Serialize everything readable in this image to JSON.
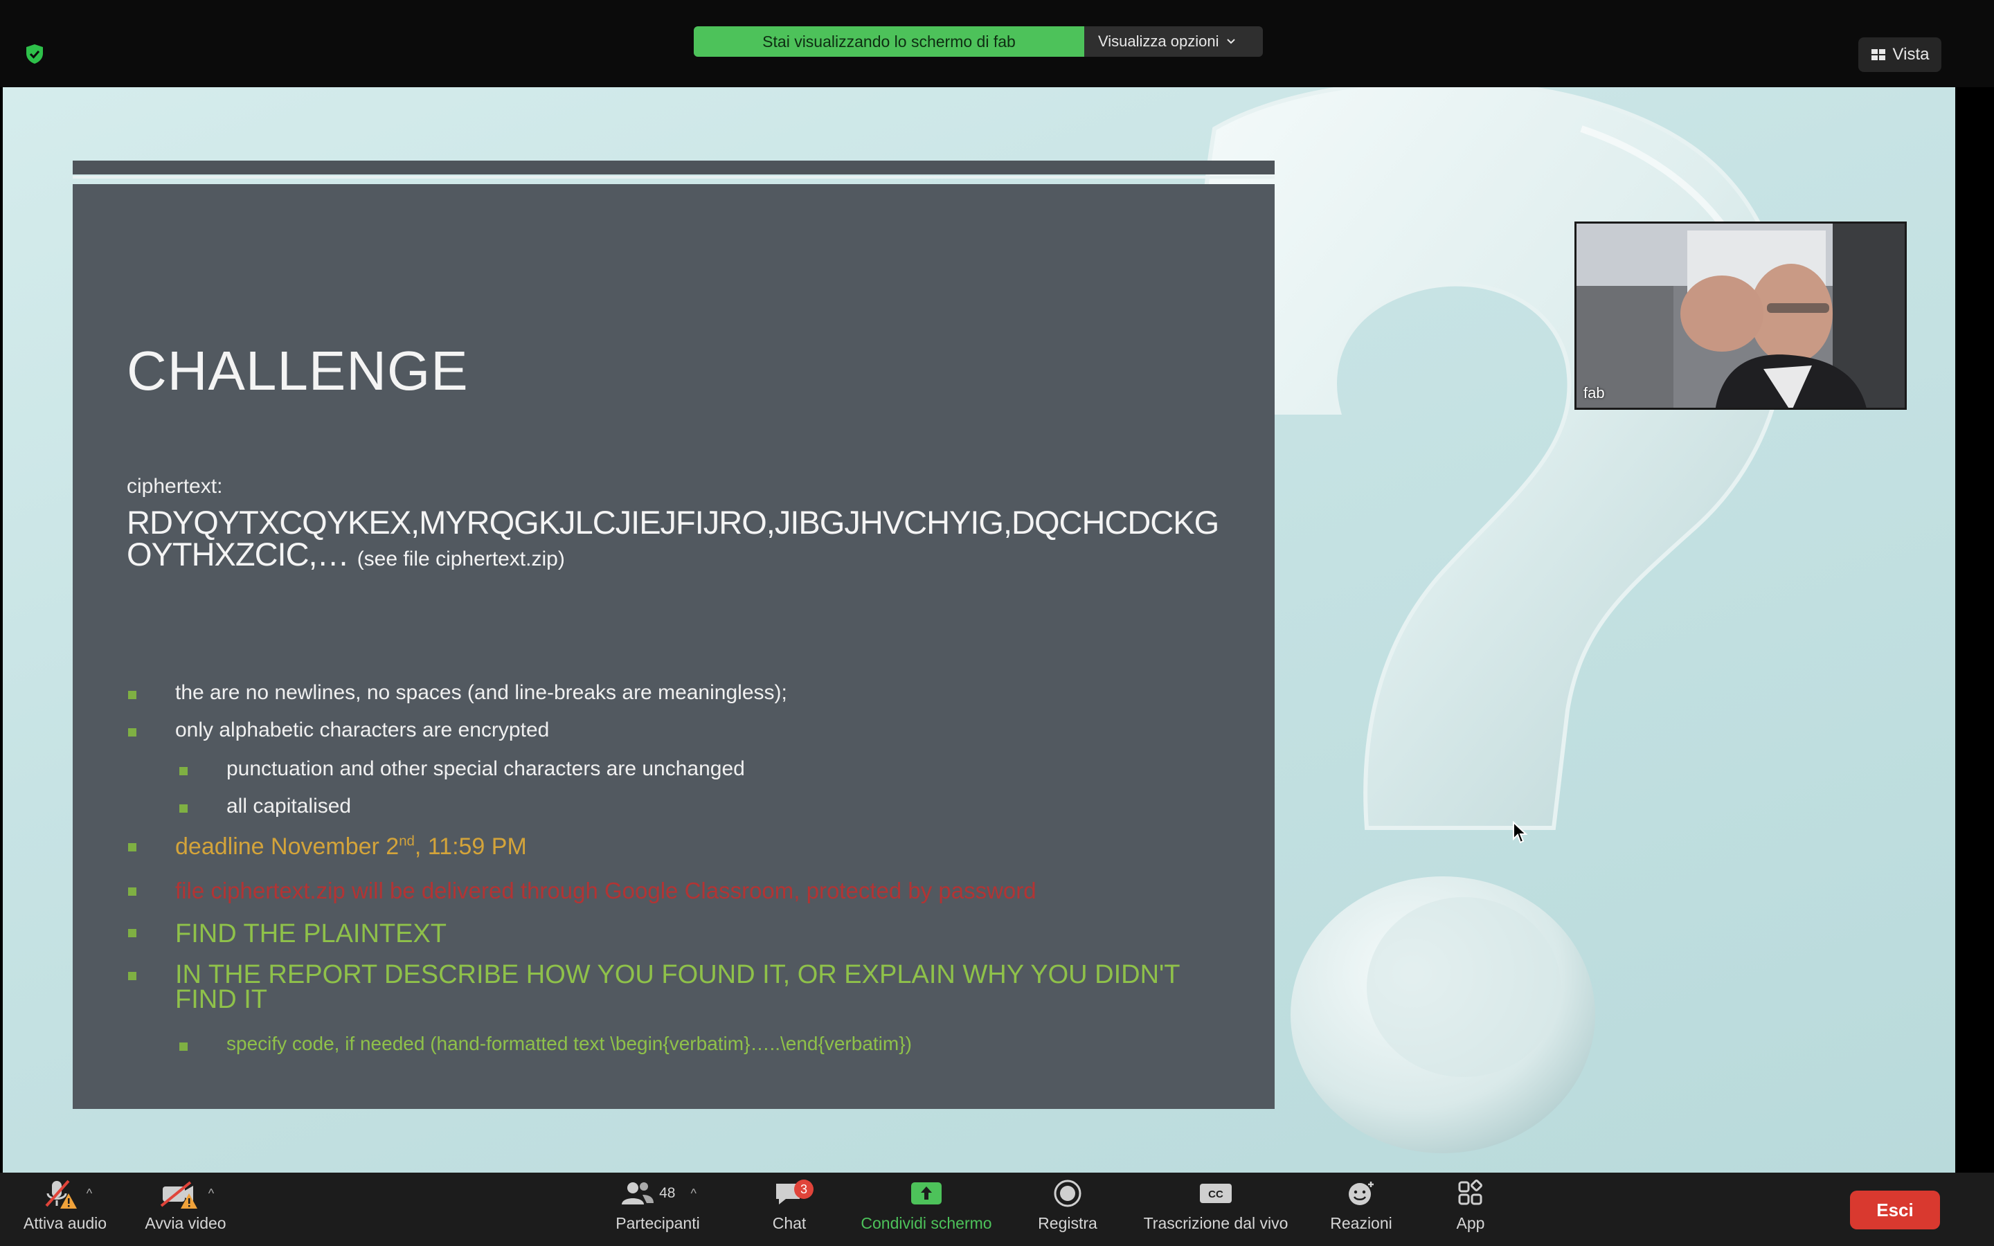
{
  "share_banner": {
    "status": "Stai visualizzando lo schermo di fab",
    "options_label": "Visualizza opzioni"
  },
  "view_button": {
    "label": "Vista"
  },
  "slide": {
    "title": "CHALLENGE",
    "cipher_label": "ciphertext:",
    "cipher_line1": "RDYQYTXCQYKEX,MYRQGKJLCJIEJFIJRO,JIBGJHVCHYIG,DQCHCDCKG",
    "cipher_line2": "OYTHXZCIC,…",
    "cipher_note": "(see file ciphertext.zip)",
    "bullet_1": "the are no newlines, no spaces (and line-breaks are meaningless);",
    "bullet_2": "only alphabetic characters are encrypted",
    "bullet_2a": "punctuation and other special characters are unchanged",
    "bullet_2b": "all capitalised",
    "deadline_prefix": "deadline November 2",
    "deadline_sup": "nd",
    "deadline_suffix": ", 11:59 PM",
    "bullet_file": "file ciphertext.zip will be delivered through Google Classroom, protected by password",
    "bullet_find": "FIND THE PLAINTEXT",
    "bullet_report": "IN THE REPORT DESCRIBE HOW YOU FOUND IT, OR EXPLAIN WHY YOU DIDN'T FIND IT",
    "bullet_code": "specify code, if needed (hand-formatted text \\begin{verbatim}…..\\end{verbatim})"
  },
  "video": {
    "participant_name": "fab"
  },
  "toolbar": {
    "audio_label": "Attiva audio",
    "video_label": "Avvia video",
    "participants_label": "Partecipanti",
    "participants_count": "48",
    "chat_label": "Chat",
    "chat_badge": "3",
    "share_label": "Condividi schermo",
    "record_label": "Registra",
    "captions_label": "Trascrizione dal vivo",
    "reactions_label": "Reazioni",
    "apps_label": "App",
    "exit_label": "Esci"
  },
  "colors": {
    "banner_green": "#4dc25a",
    "slide_bg": "#525960",
    "bullet_green": "#8fc14a",
    "deadline_gold": "#d4a43a",
    "warning_red": "#b23434",
    "exit_red": "#d9392f"
  }
}
